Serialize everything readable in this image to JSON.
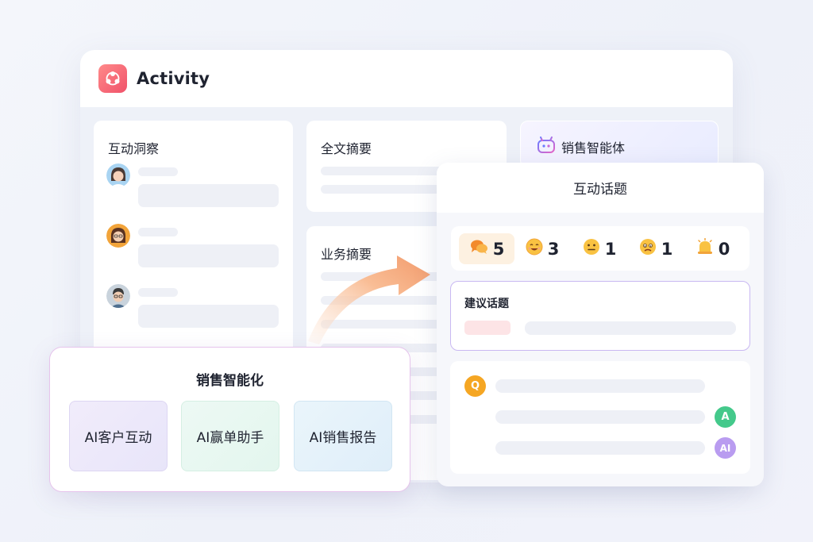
{
  "app": {
    "title": "Activity"
  },
  "insight": {
    "title": "互动洞察"
  },
  "full_summary": {
    "title": "全文摘要"
  },
  "business_summary": {
    "title": "业务摘要"
  },
  "agent": {
    "title": "销售智能体"
  },
  "topic_panel": {
    "title": "互动话题",
    "stats": [
      {
        "icon": "chat-bubbles-icon",
        "count": "5"
      },
      {
        "icon": "smile-face-icon",
        "count": "3"
      },
      {
        "icon": "neutral-face-icon",
        "count": "1"
      },
      {
        "icon": "worried-face-icon",
        "count": "1"
      },
      {
        "icon": "alert-bell-icon",
        "count": "0"
      }
    ],
    "suggested_title": "建议话题",
    "qa": {
      "q_badge": "Q",
      "a_badge": "A",
      "ai_badge": "AI"
    }
  },
  "sales": {
    "title": "销售智能化",
    "tiles": [
      "AI客户互动",
      "AI赢单助手",
      "AI销售报告"
    ]
  },
  "colors": {
    "brand": "#f0526a",
    "q_badge": "#f5a623",
    "a_badge": "#44c98b",
    "ai_badge": "#b99cf0",
    "suggest_border": "#c9b8f2"
  }
}
